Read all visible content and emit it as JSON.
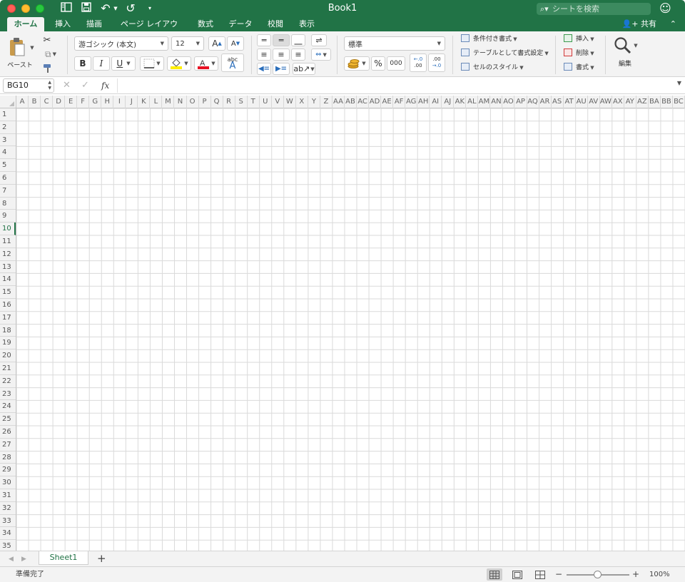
{
  "titlebar": {
    "document_title": "Book1",
    "search_placeholder": "シートを検索"
  },
  "tabs": [
    {
      "label": "ホーム",
      "active": true
    },
    {
      "label": "挿入",
      "active": false
    },
    {
      "label": "描画",
      "active": false
    },
    {
      "label": "ページ レイアウト",
      "active": false
    },
    {
      "label": "数式",
      "active": false
    },
    {
      "label": "データ",
      "active": false
    },
    {
      "label": "校閲",
      "active": false
    },
    {
      "label": "表示",
      "active": false
    }
  ],
  "share_label": "共有",
  "ribbon": {
    "paste_label": "ペースト",
    "font_name": "游ゴシック (本文)",
    "font_size": "12",
    "bold": "B",
    "italic": "I",
    "underline": "U",
    "number_format": "標準",
    "percent": "%",
    "comma": "000",
    "increase_decimal_top": "←.0",
    "increase_decimal_bottom": ".00",
    "decrease_decimal_top": ".00",
    "decrease_decimal_bottom": "→.0",
    "conditional_formatting": "条件付き書式",
    "format_as_table": "テーブルとして書式設定",
    "cell_styles": "セルのスタイル",
    "insert": "挿入",
    "delete": "削除",
    "format": "書式",
    "editing": "編集",
    "grow_font": "A",
    "shrink_font": "A",
    "phonetic": "abc",
    "phonetic_big": "A"
  },
  "formula_bar": {
    "name_box": "BG10",
    "fx_label": "fx",
    "formula": ""
  },
  "grid": {
    "columns": [
      "A",
      "B",
      "C",
      "D",
      "E",
      "F",
      "G",
      "H",
      "I",
      "J",
      "K",
      "L",
      "M",
      "N",
      "O",
      "P",
      "Q",
      "R",
      "S",
      "T",
      "U",
      "V",
      "W",
      "X",
      "Y",
      "Z",
      "AA",
      "AB",
      "AC",
      "AD",
      "AE",
      "AF",
      "AG",
      "AH",
      "AI",
      "AJ",
      "AK",
      "AL",
      "AM",
      "AN",
      "AO",
      "AP",
      "AQ",
      "AR",
      "AS",
      "AT",
      "AU",
      "AV",
      "AW",
      "AX",
      "AY",
      "AZ",
      "BA",
      "BB",
      "BC"
    ],
    "rows": [
      "1",
      "2",
      "3",
      "4",
      "5",
      "6",
      "7",
      "8",
      "9",
      "10",
      "11",
      "12",
      "13",
      "14",
      "15",
      "16",
      "17",
      "18",
      "19",
      "20",
      "21",
      "22",
      "23",
      "24",
      "25",
      "26",
      "27",
      "28",
      "29",
      "30",
      "31",
      "32",
      "33",
      "34",
      "35"
    ],
    "active_row": "10"
  },
  "sheet_tabs": [
    "Sheet1"
  ],
  "status": {
    "text": "準備完了",
    "zoom": "100%",
    "zoom_level": 1.0
  },
  "colors": {
    "accent": "#217346",
    "font_color_bar": "#e81123",
    "highlight_bar": "#ffef00"
  }
}
